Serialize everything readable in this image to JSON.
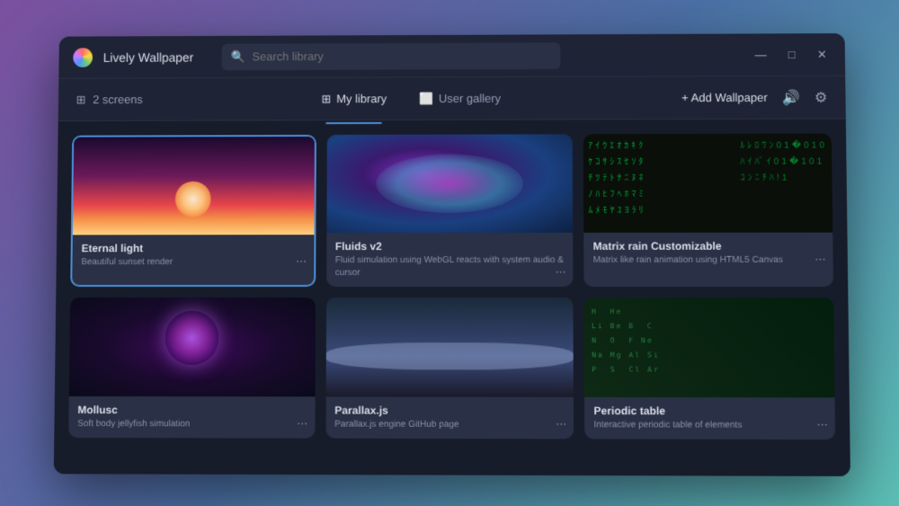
{
  "app": {
    "title": "Lively Wallpaper",
    "logo_label": "Lively logo"
  },
  "search": {
    "placeholder": "Search library",
    "value": ""
  },
  "window_controls": {
    "minimize": "—",
    "maximize": "□",
    "close": "✕"
  },
  "toolbar": {
    "screens_icon": "⊞",
    "screens_label": "2 screens",
    "tabs": [
      {
        "id": "my-library",
        "icon": "⊞",
        "label": "My library",
        "active": true
      },
      {
        "id": "user-gallery",
        "icon": "⬜",
        "label": "User gallery",
        "active": false
      }
    ],
    "add_label": "+ Add Wallpaper",
    "volume_icon": "🔊",
    "settings_icon": "⚙"
  },
  "wallpapers": [
    {
      "id": "eternal-light",
      "title": "Eternal light",
      "description": "Beautiful sunset render",
      "thumb_type": "eternal",
      "selected": true
    },
    {
      "id": "fluids-v2",
      "title": "Fluids v2",
      "description": "Fluid simulation using WebGL reacts with system audio & cursor",
      "thumb_type": "fluids",
      "selected": false
    },
    {
      "id": "matrix-rain",
      "title": "Matrix rain Customizable",
      "description": "Matrix like rain animation using HTML5 Canvas",
      "thumb_type": "matrix",
      "selected": false
    },
    {
      "id": "mollusc",
      "title": "Mollusc",
      "description": "Soft body jellyfish simulation",
      "thumb_type": "jellyfish",
      "selected": false
    },
    {
      "id": "parallax-js",
      "title": "Parallax.js",
      "description": "Parallax.js engine GitHub page",
      "thumb_type": "parallax",
      "selected": false
    },
    {
      "id": "periodic-table",
      "title": "Periodic table",
      "description": "Interactive periodic table of elements",
      "thumb_type": "periodic",
      "selected": false
    }
  ]
}
